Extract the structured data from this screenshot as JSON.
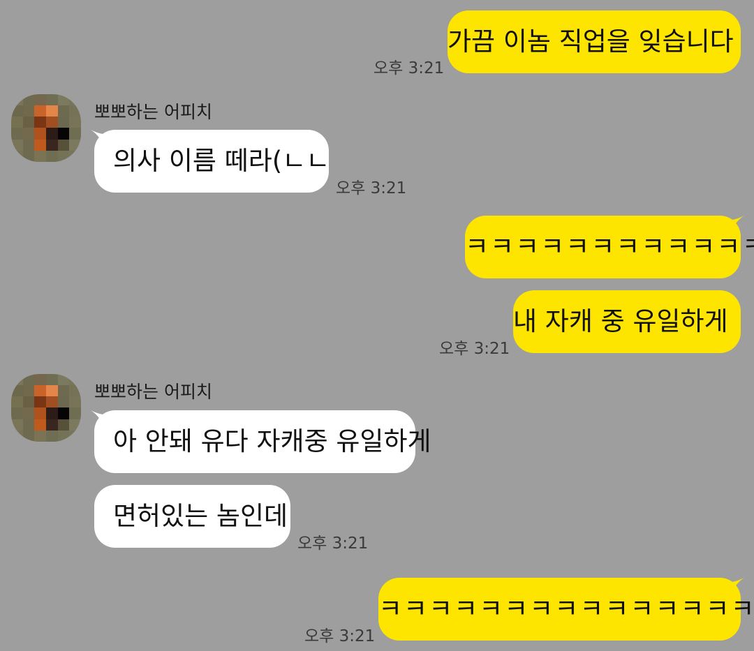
{
  "colors": {
    "background": "#9e9e9e",
    "my_bubble": "#fee500",
    "other_bubble": "#ffffff"
  },
  "messages": [
    {
      "text": "가끔 이놈 직업을 잊습니다",
      "time": "오후 3:21"
    },
    {
      "sender": "뽀뽀하는 어피치",
      "text": "의사 이름 떼라(ㄴㄴ",
      "time": "오후 3:21"
    },
    {
      "text": "ㅋㅋㅋㅋㅋㅋㅋㅋㅋㅋㅋㅋ"
    },
    {
      "text": "내 자캐 중 유일하게",
      "time": "오후 3:21"
    },
    {
      "sender": "뽀뽀하는 어피치",
      "text": "아 안돼 유다 자캐중 유일하게"
    },
    {
      "text": "면허있는 놈인데",
      "time": "오후 3:21"
    },
    {
      "text": "ㅋㅋㅋㅋㅋㅋㅋㅋㅋㅋㅋㅋㅋㅋㅋㅋ",
      "time": "오후 3:21"
    }
  ]
}
